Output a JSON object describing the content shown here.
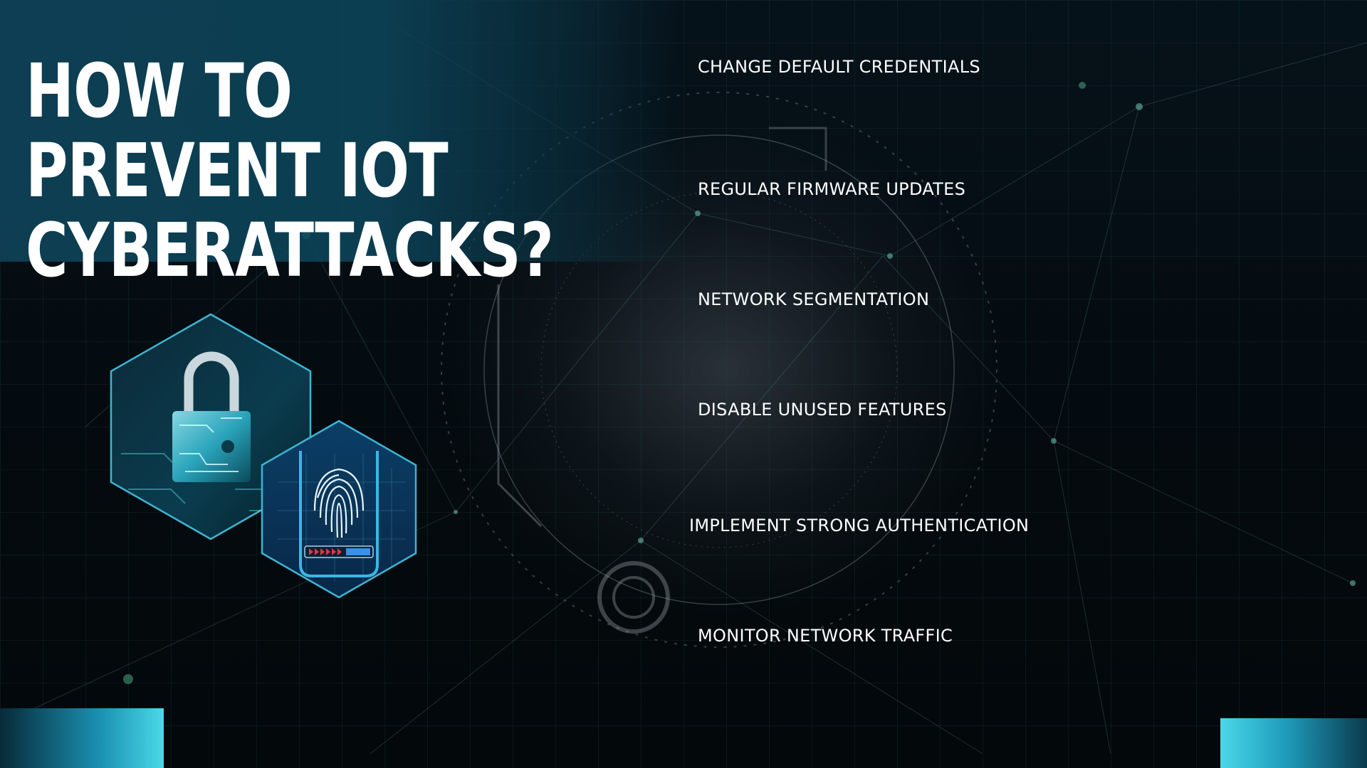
{
  "slide": {
    "title": "HOW TO PREVENT IOT CYBERATTACKS?"
  },
  "steps": [
    "CHANGE DEFAULT CREDENTIALS",
    "REGULAR FIRMWARE UPDATES",
    "NETWORK SEGMENTATION",
    "DISABLE UNUSED FEATURES",
    "IMPLEMENT STRONG AUTHENTICATION",
    "MONITOR NETWORK TRAFFIC"
  ],
  "colors": {
    "title_band": "#0e4056",
    "accent": "#49d6e6",
    "text": "#ffffff",
    "background": "#05090c"
  },
  "icons": [
    "padlock-icon",
    "fingerprint-icon"
  ]
}
